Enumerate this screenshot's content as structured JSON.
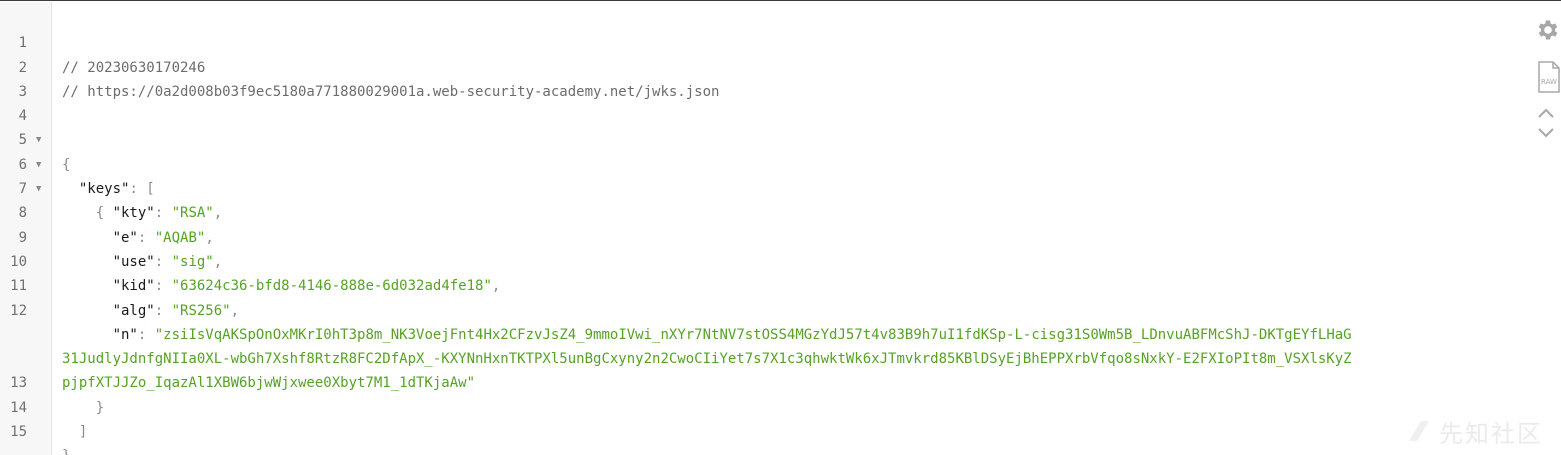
{
  "toolbar": {
    "settings_icon": "gear-icon",
    "raw_icon": "raw-file-icon",
    "raw_label": "RAW",
    "collapse_icon": "chevron-up-icon",
    "expand_icon": "chevron-down-icon"
  },
  "lines": [
    {
      "n": "1",
      "comment": "// 20230630170246"
    },
    {
      "n": "2",
      "comment": "// https://0a2d008b03f9ec5180a771880029001a.web-security-academy.net/jwks.json"
    },
    {
      "n": "3"
    },
    {
      "n": "4",
      "fold": "▼",
      "open": "{"
    },
    {
      "n": "5",
      "fold": "▼",
      "key": "\"keys\"",
      "colon": ": ",
      "open": "["
    },
    {
      "n": "6",
      "fold": "▼",
      "open": "{"
    },
    {
      "n": "7",
      "key": "\"kty\"",
      "colon": ": ",
      "value": "\"RSA\"",
      "comma": ","
    },
    {
      "n": "8",
      "key": "\"e\"",
      "colon": ": ",
      "value": "\"AQAB\"",
      "comma": ","
    },
    {
      "n": "9",
      "key": "\"use\"",
      "colon": ": ",
      "value": "\"sig\"",
      "comma": ","
    },
    {
      "n": "10",
      "key": "\"kid\"",
      "colon": ": ",
      "value": "\"63624c36-bfd8-4146-888e-6d032ad4fe18\"",
      "comma": ","
    },
    {
      "n": "11",
      "key": "\"alg\"",
      "colon": ": ",
      "value": "\"RS256\"",
      "comma": ","
    },
    {
      "n": "12",
      "key": "\"n\"",
      "colon": ": ",
      "value": "\"zsiIsVqAKSpOnOxMKrI0hT3p8m_NK3VoejFnt4Hx2CFzvJsZ4_9mmoIVwi_nXYr7NtNV7stOSS4MGzYdJ57t4v83B9h7uI1fdKSp-L-cisg31S0Wm5B_LDnvuABFMcShJ-DKTgEYfLHaG31JudlyJdnfgNIIa0XL-wbGh7Xshf8RtzR8FC2DfApX_-KXYNnHxnTKTPXl5unBgCxyny2n2CwoCIiYet7s7X1c3qhwktWk6xJTmvkrd85KBlDSyEjBhEPPXrbVfqo8sNxkY-E2FXIoPIt8m_VSXlsKyZpjpfXTJJZo_IqazAl1XBW6bjwWjxwee0Xbyt7M1_1dTKjaAw\""
    },
    {
      "n": "13",
      "close": "}"
    },
    {
      "n": "14",
      "close": "]"
    },
    {
      "n": "15",
      "close": "}"
    }
  ],
  "watermark": {
    "text": "先知社区"
  }
}
